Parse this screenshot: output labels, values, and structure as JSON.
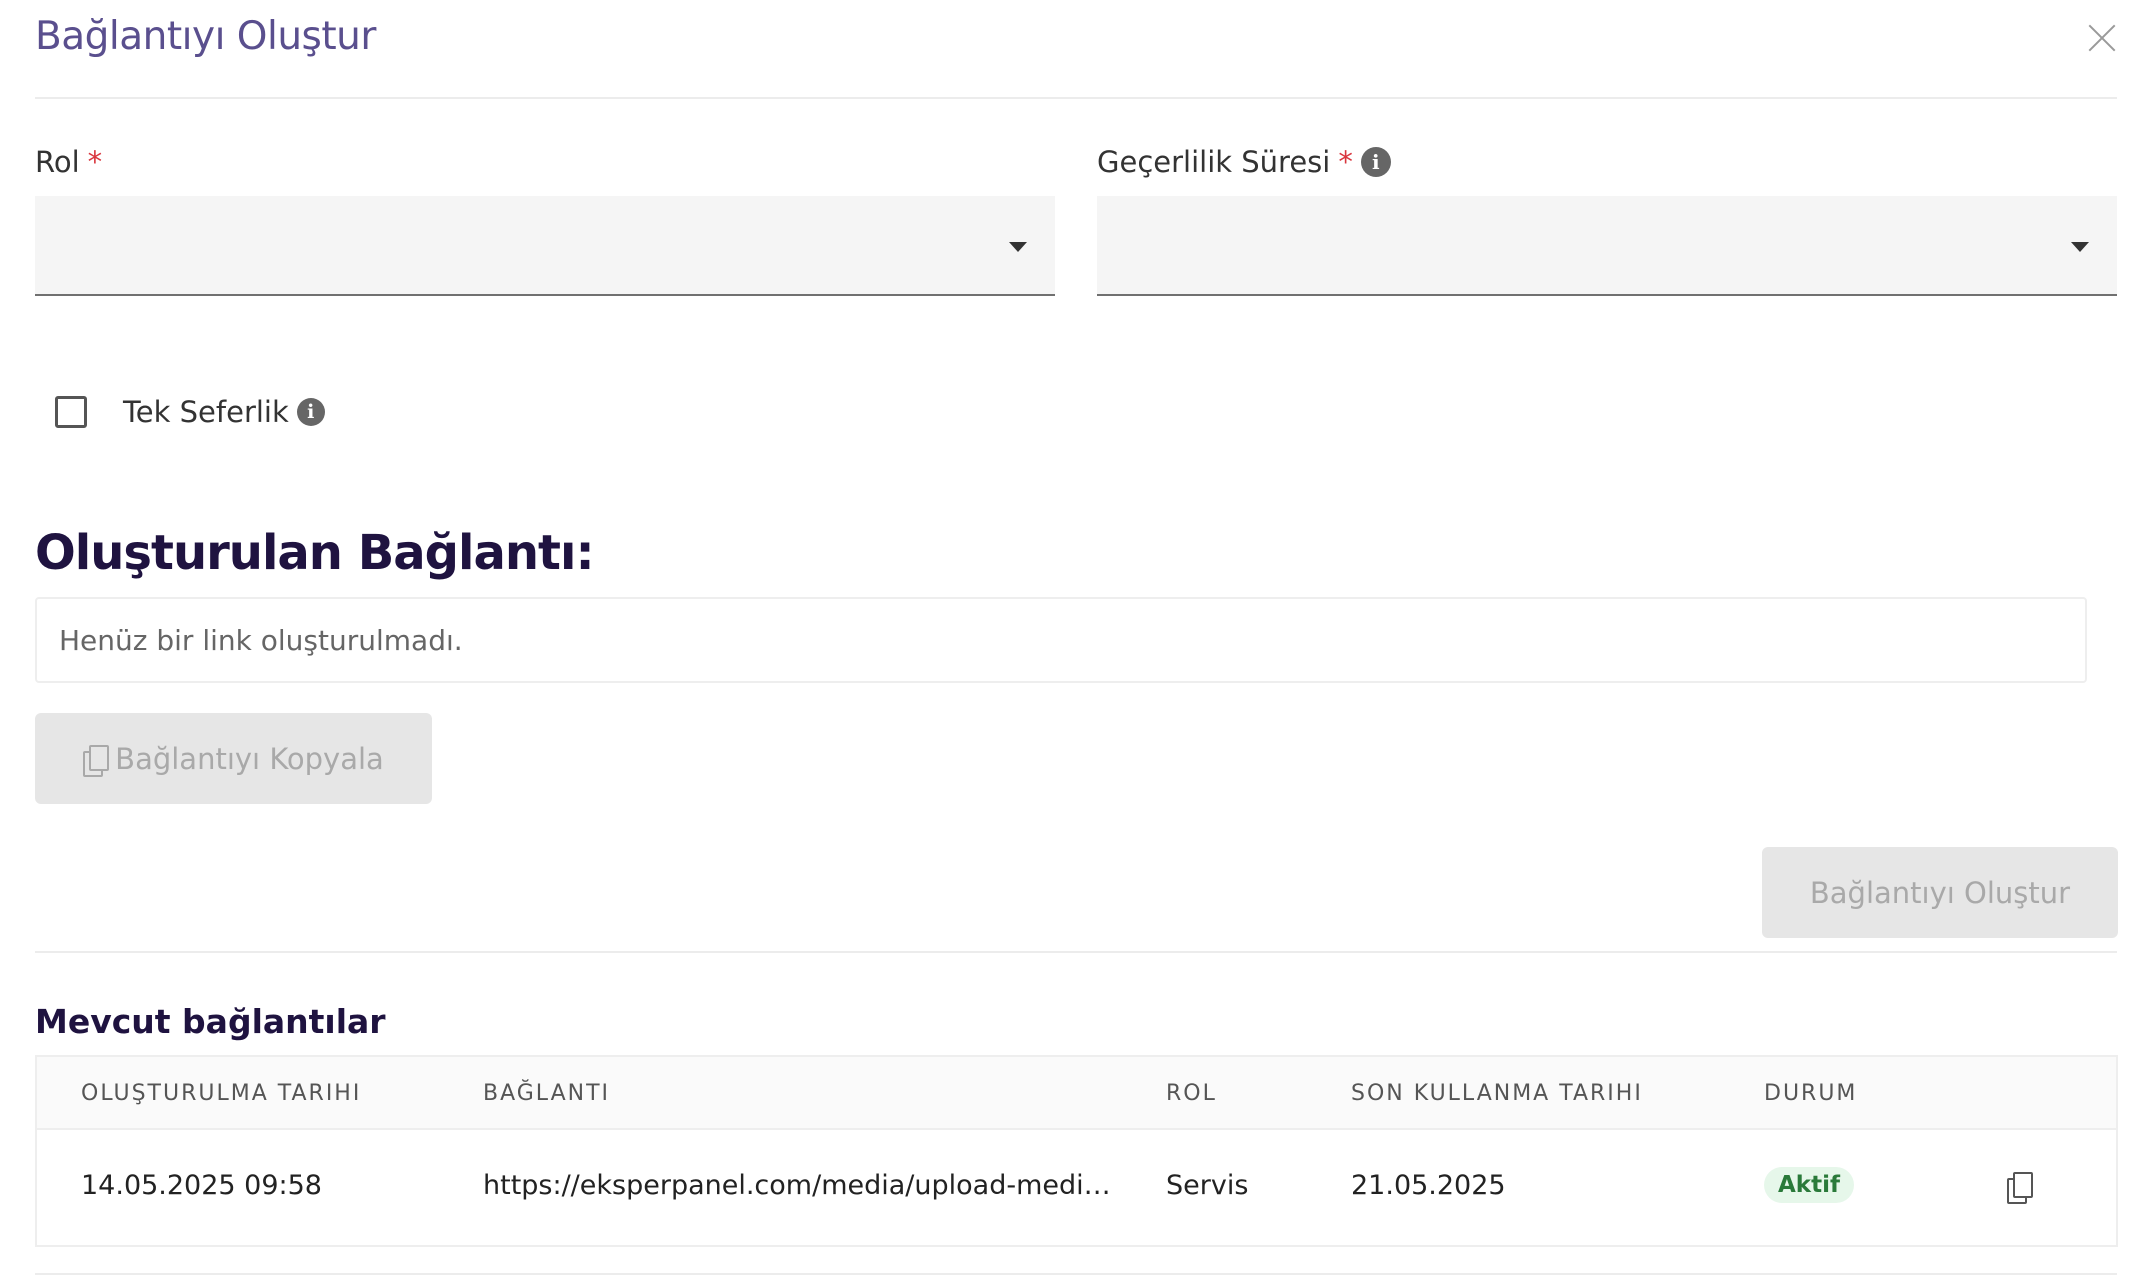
{
  "dialog": {
    "title": "Bağlantıyı Oluştur"
  },
  "form": {
    "role": {
      "label": "Rol",
      "required_mark": "*",
      "value": ""
    },
    "validity": {
      "label": "Geçerlilik Süresi",
      "required_mark": "*",
      "info_icon": "info-icon",
      "value": ""
    },
    "single_use": {
      "label": "Tek Seferlik",
      "checked": false,
      "info_icon": "info-icon"
    }
  },
  "generated": {
    "title": "Oluşturulan Bağlantı:",
    "placeholder": "Henüz bir link oluşturulmadı.",
    "copy_button": "Bağlantıyı Kopyala"
  },
  "actions": {
    "create_button": "Bağlantıyı Oluştur"
  },
  "existing": {
    "title": "Mevcut bağlantılar",
    "columns": [
      "OLUŞTURULMA TARIHI",
      "BAĞLANTI",
      "ROL",
      "SON KULLANMA TARIHI",
      "DURUM"
    ],
    "rows": [
      {
        "created": "14.05.2025 09:58",
        "link": "https://eksperpanel.com/media/upload-media/4...",
        "role": "Servis",
        "expires": "21.05.2025",
        "status": "Aktif"
      }
    ]
  },
  "colors": {
    "title": "#5a4f8e",
    "heading": "#1f1340",
    "required": "#d9363e",
    "badge_bg": "#e6f7ea",
    "badge_text": "#2a7a3a"
  }
}
